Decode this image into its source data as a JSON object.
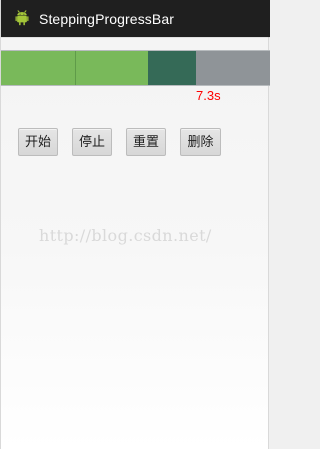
{
  "app": {
    "title": "SteppingProgressBar"
  },
  "progress": {
    "timeText": "7.3s",
    "segments": [
      {
        "color": "#79b95a"
      },
      {
        "color": "#79b95a"
      },
      {
        "color": "#356a57"
      }
    ],
    "remainingColor": "#8f9498"
  },
  "buttons": {
    "start": "开始",
    "stop": "停止",
    "reset": "重置",
    "delete": "删除"
  },
  "watermark": {
    "text": "http://blog.csdn.net/"
  },
  "icons": {
    "app": "android-icon"
  }
}
